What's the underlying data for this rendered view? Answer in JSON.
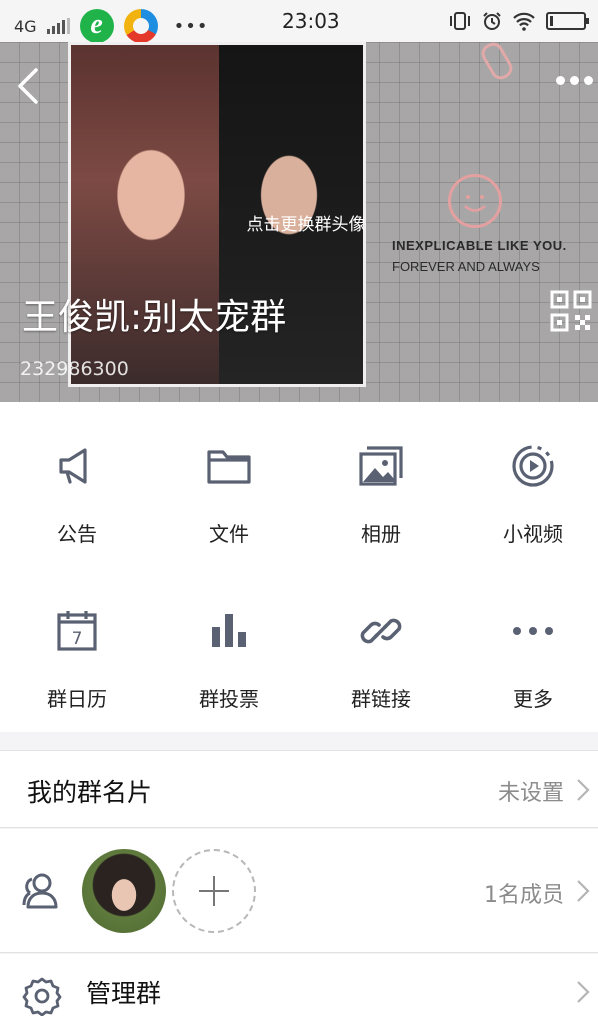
{
  "status_bar": {
    "network": "4G",
    "time": "23:03",
    "overflow": "•••",
    "icons": [
      "signal-icon",
      "browser-e-icon",
      "browser-ring-icon",
      "vibrate-icon",
      "alarm-icon",
      "wifi-icon",
      "battery-icon"
    ]
  },
  "header": {
    "change_avatar": "点击更换群头像",
    "group_name": "王俊凯:别太宠群",
    "group_id": "232986300",
    "poster_line1": "INEXPLICABLE LIKE YOU.",
    "poster_line2": "FOREVER AND ALWAYS"
  },
  "features": [
    {
      "label": "公告",
      "icon": "megaphone-icon"
    },
    {
      "label": "文件",
      "icon": "folder-icon"
    },
    {
      "label": "相册",
      "icon": "album-icon"
    },
    {
      "label": "小视频",
      "icon": "video-icon"
    },
    {
      "label": "群日历",
      "icon": "calendar-icon"
    },
    {
      "label": "群投票",
      "icon": "vote-chart-icon"
    },
    {
      "label": "群链接",
      "icon": "link-icon"
    },
    {
      "label": "更多",
      "icon": "more-icon"
    }
  ],
  "calendar_day": "7",
  "my_card": {
    "title": "我的群名片",
    "value": "未设置"
  },
  "members": {
    "count": "1名成员"
  },
  "manage": {
    "title": "管理群"
  },
  "colors": {
    "icon": "#5a6172",
    "muted": "#8c8c8c",
    "divider": "#e2e2e2"
  }
}
